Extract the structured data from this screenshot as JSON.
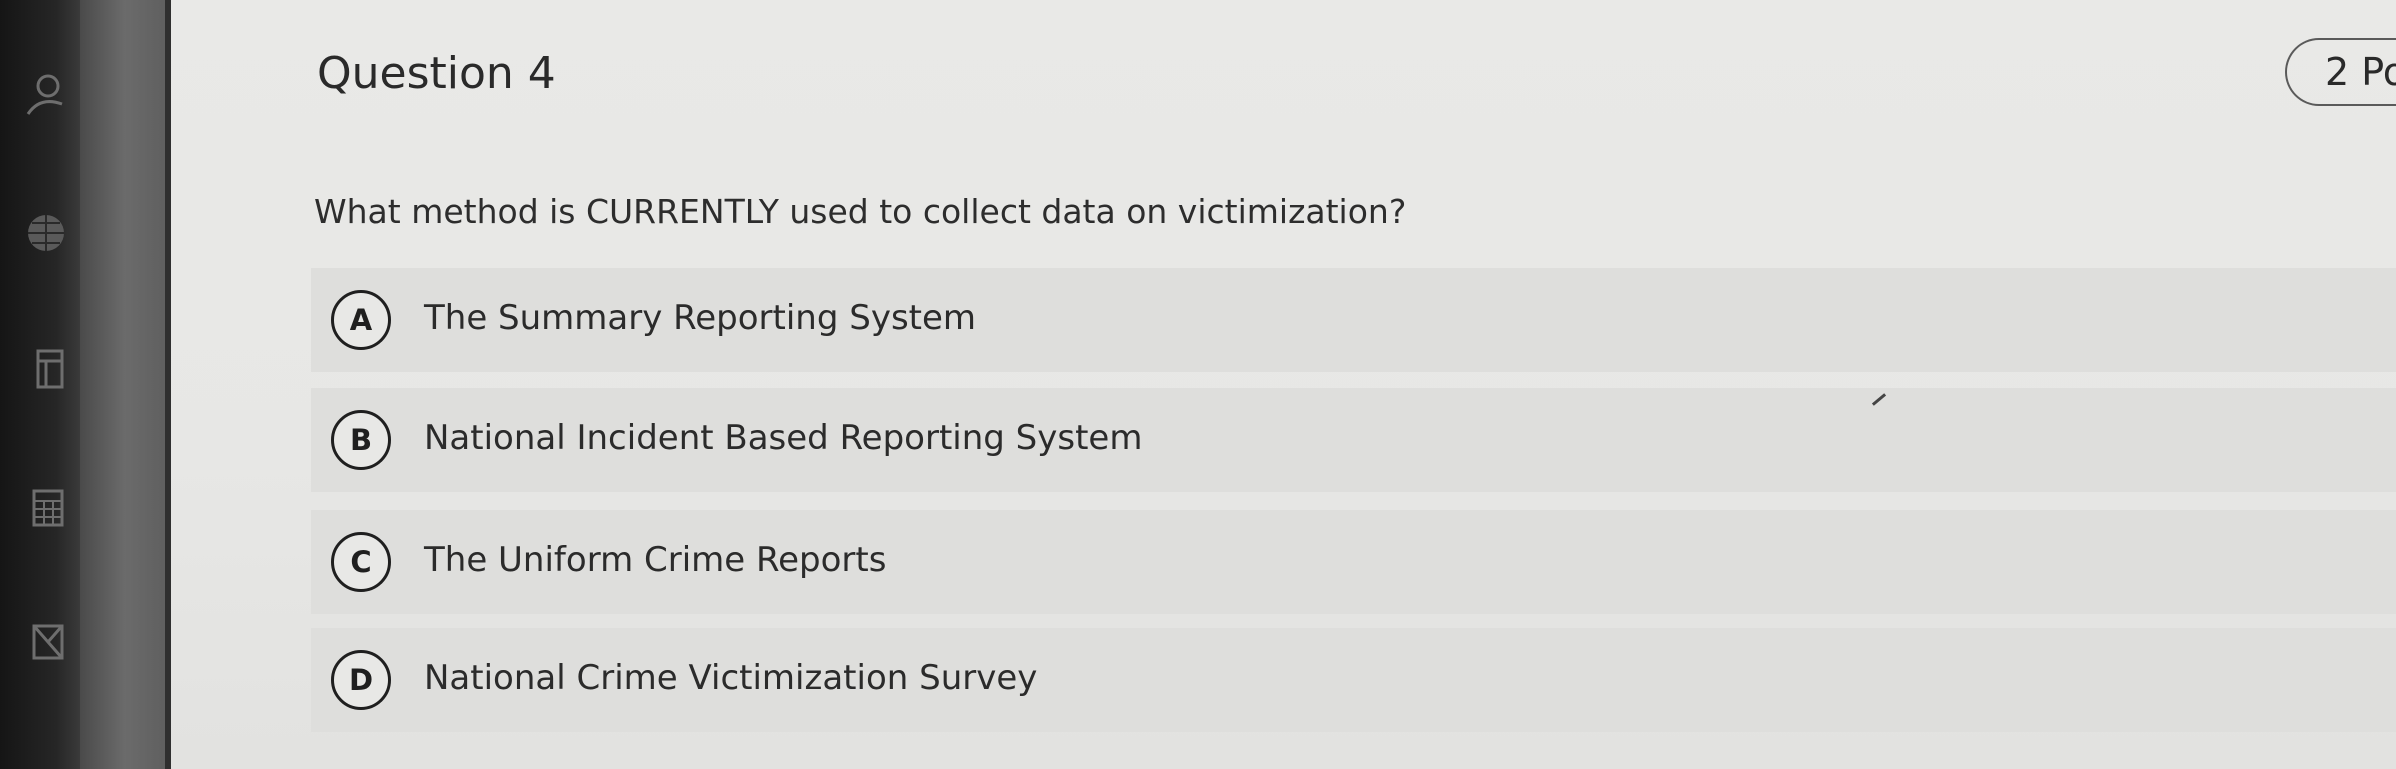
{
  "question": {
    "title": "Question 4",
    "points_label": "2 Po",
    "prompt": "What method is CURRENTLY used to collect data on victimization?"
  },
  "options": [
    {
      "letter": "A",
      "label": "The Summary Reporting System"
    },
    {
      "letter": "B",
      "label": "National Incident Based Reporting System"
    },
    {
      "letter": "C",
      "label": "The Uniform Crime Reports"
    },
    {
      "letter": "D",
      "label": "National Crime Victimization Survey"
    }
  ],
  "sidebar": {
    "icons": [
      "user-icon",
      "globe-icon",
      "calendar-icon",
      "grid-icon",
      "inbox-icon"
    ]
  }
}
